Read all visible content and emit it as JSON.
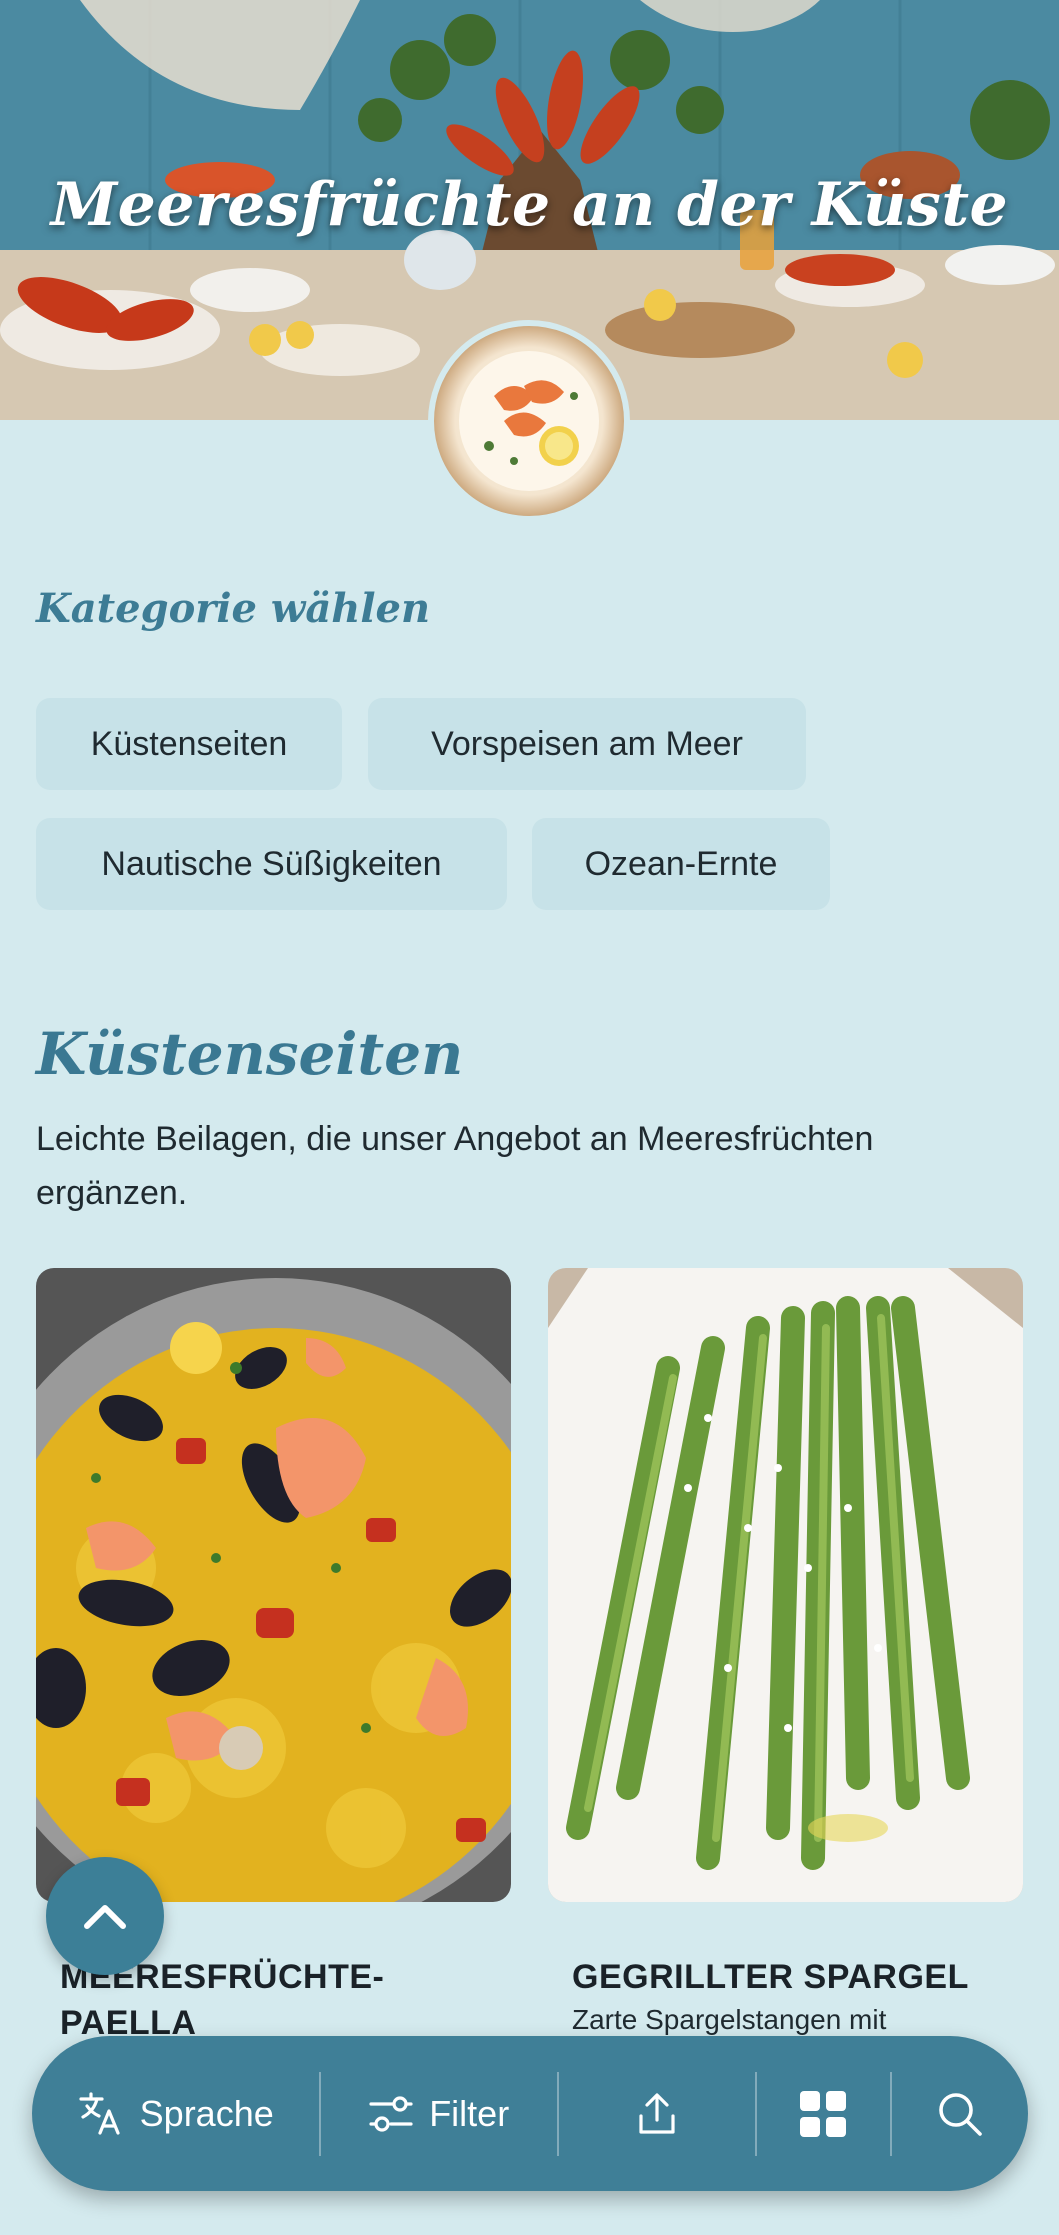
{
  "hero": {
    "title": "Meeresfrüchte an der Küste"
  },
  "category_section": {
    "heading": "Kategorie wählen",
    "chips": [
      {
        "label": "Küstenseiten"
      },
      {
        "label": "Vorspeisen am Meer"
      },
      {
        "label": "Nautische Süßigkeiten"
      },
      {
        "label": "Ozean-Ernte"
      }
    ]
  },
  "section": {
    "heading": "Küstenseiten",
    "description": "Leichte Beilagen, die unser Angebot an Meeresfrüchten ergänzen."
  },
  "dishes": [
    {
      "title": "MEERESFRÜCHTE-PAELLA",
      "title_line1": "MEERESFRÜCHTE-",
      "title_line2": "PAELLA",
      "description": ""
    },
    {
      "title": "GEGRILLTER SPARGEL",
      "description": "Zarte Spargelstangen mit"
    }
  ],
  "bottom_bar": {
    "language_label": "Sprache",
    "filter_label": "Filter",
    "icons": [
      "translate-icon",
      "filter-icon",
      "share-icon",
      "grid-icon",
      "search-icon"
    ]
  },
  "colors": {
    "background": "#d4eaee",
    "accent": "#3f7f97",
    "chip": "#c7e2e8",
    "heading": "#3a7892"
  }
}
